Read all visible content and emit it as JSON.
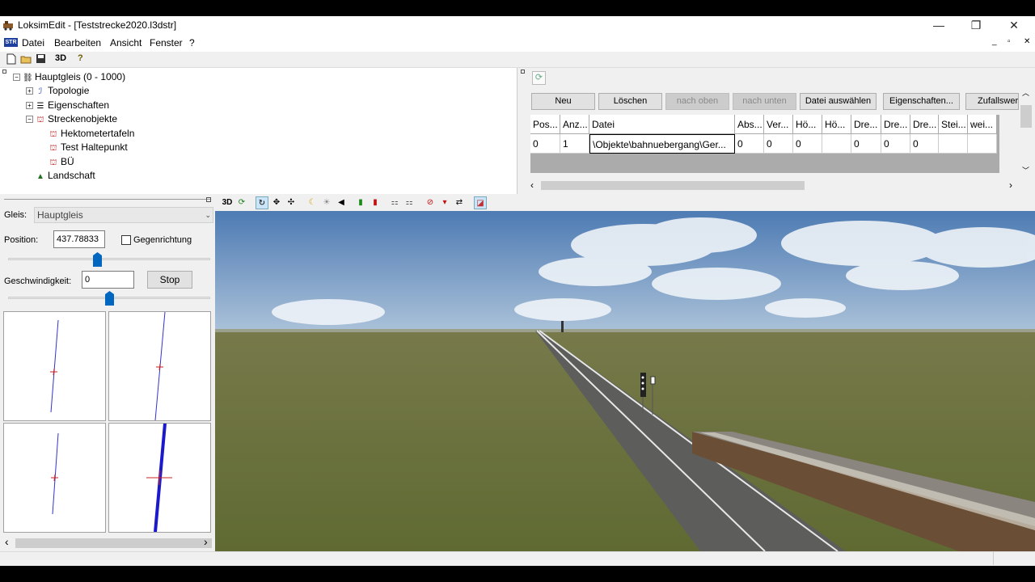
{
  "window": {
    "title": "LoksimEdit - [Teststrecke2020.l3dstr]",
    "minimize": "—",
    "restore": "❐",
    "close": "✕"
  },
  "menu": {
    "logo": "STR",
    "items": [
      "Datei",
      "Bearbeiten",
      "Ansicht",
      "Fenster",
      "?"
    ],
    "mdi_min": "_",
    "mdi_restore": "▫",
    "mdi_close": "✕"
  },
  "toolbar": {
    "new_icon": "new-file-icon",
    "open_icon": "open-folder-icon",
    "save_icon": "save-icon",
    "three_d": "3D",
    "help": "?"
  },
  "tree": {
    "root": {
      "label": "Hauptgleis (0 - 1000)",
      "expander": "−"
    },
    "topologie": {
      "label": "Topologie",
      "expander": "+"
    },
    "eigenschaften": {
      "label": "Eigenschaften",
      "expander": "+"
    },
    "streckenobjekte": {
      "label": "Streckenobjekte",
      "expander": "−"
    },
    "hektometer": {
      "label": "Hektometertafeln"
    },
    "haltepunkt": {
      "label": "Test Haltepunkt"
    },
    "bue": {
      "label": "BÜ"
    },
    "landschaft": {
      "label": "Landschaft"
    }
  },
  "objects_panel": {
    "buttons": {
      "neu": "Neu",
      "loeschen": "Löschen",
      "nach_oben": "nach oben",
      "nach_unten": "nach unten",
      "datei_auswaehlen": "Datei auswählen",
      "eigenschaften": "Eigenschaften...",
      "zufallswert": "Zufallswert"
    },
    "columns": [
      "Pos...",
      "Anz...",
      "Datei",
      "Abs...",
      "Ver...",
      "Hö...",
      "Hö...",
      "Dre...",
      "Dre...",
      "Dre...",
      "Stei...",
      "wei..."
    ],
    "rows": [
      [
        "0",
        "1",
        "\\Objekte\\bahnuebergang\\Ger...",
        "0",
        "0",
        "0",
        "",
        "0",
        "0",
        "0",
        "",
        ""
      ]
    ]
  },
  "controls": {
    "gleis_label": "Gleis:",
    "gleis_value": "Hauptgleis",
    "position_label": "Position:",
    "position_value": "437.78833",
    "gegenrichtung_label": "Gegenrichtung",
    "geschwindigkeit_label": "Geschwindigkeit:",
    "geschwindigkeit_value": "0",
    "stop": "Stop"
  },
  "view_toolbar": {
    "three_d": "3D"
  },
  "colors": {
    "sky_top": "#4d7bb3",
    "sky_bottom": "#a9c0d8",
    "grass": "#6b7138",
    "accent_blue": "#0067c0"
  }
}
